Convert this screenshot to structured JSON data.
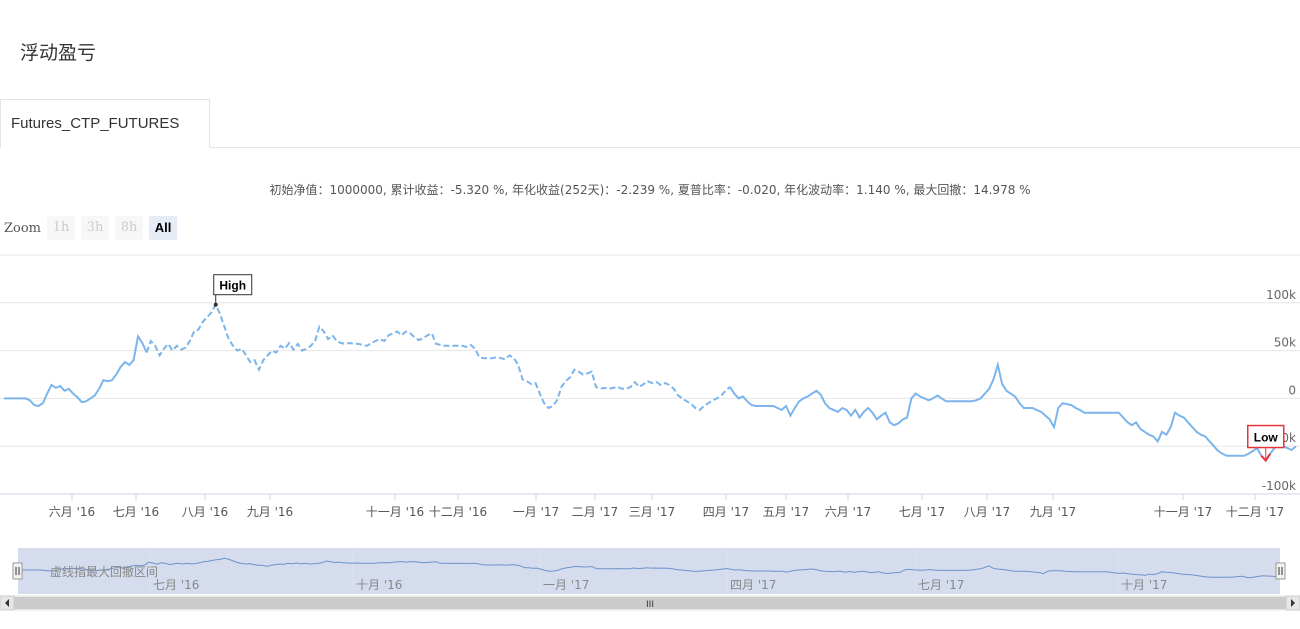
{
  "page": {
    "title": "浮动盈亏",
    "tab_label": "Futures_CTP_FUTURES",
    "stats_text": "初始净值：1000000, 累计收益：-5.320 %, 年化收益(252天)：-2.239 %, 夏普比率：-0.020, 年化波动率：1.140 %, 最大回撤：14.978 %"
  },
  "zoom": {
    "label": "Zoom",
    "buttons": [
      {
        "label": "1h",
        "state": "disabled"
      },
      {
        "label": "3h",
        "state": "disabled"
      },
      {
        "label": "8h",
        "state": "disabled"
      },
      {
        "label": "All",
        "state": "active"
      }
    ]
  },
  "navigator": {
    "legend_text": "虚线指最大回撤区间",
    "ticks": [
      "七月 '16",
      "十月 '16",
      "一月 '17",
      "四月 '17",
      "七月 '17",
      "十月 '17"
    ],
    "scroll_grip": "III"
  },
  "chart_data": {
    "type": "line",
    "x_tick_labels": [
      "六月 '16",
      "七月 '16",
      "八月 '16",
      "九月 '16",
      "十一月 '16",
      "十二月 '16",
      "一月 '17",
      "二月 '17",
      "三月 '17",
      "四月 '17",
      "五月 '17",
      "六月 '17",
      "七月 '17",
      "八月 '17",
      "九月 '17",
      "十一月 '17",
      "十二月 '17"
    ],
    "y_ticks": [
      {
        "value": 100000,
        "label": "100k"
      },
      {
        "value": 50000,
        "label": "50k"
      },
      {
        "value": 0,
        "label": "0"
      },
      {
        "value": -50000,
        "label": "-50k"
      },
      {
        "value": -100000,
        "label": "-100k"
      }
    ],
    "ylim": [
      -100000,
      150000
    ],
    "annotations": [
      {
        "label": "High",
        "value": 98000
      },
      {
        "label": "Low",
        "value": -65000
      }
    ],
    "line_color": "#7cb5ec",
    "low_color": "#e8323c",
    "drawdown_segments": [
      {
        "from_index": 33,
        "to_index": 168
      }
    ],
    "values": [
      0,
      0,
      0,
      0,
      0,
      0,
      -2000,
      -7000,
      -8000,
      -5000,
      5000,
      14000,
      11000,
      13000,
      8000,
      10000,
      5000,
      1000,
      -4000,
      -3000,
      0,
      3000,
      10000,
      19000,
      18000,
      19000,
      25000,
      33000,
      38000,
      35000,
      40000,
      65000,
      58000,
      48000,
      60000,
      55000,
      45000,
      52000,
      57000,
      50000,
      55000,
      51000,
      53000,
      60000,
      70000,
      72000,
      80000,
      85000,
      90000,
      98000,
      88000,
      75000,
      62000,
      55000,
      50000,
      52000,
      45000,
      38000,
      40000,
      30000,
      40000,
      45000,
      50000,
      48000,
      55000,
      52000,
      58000,
      51000,
      57000,
      50000,
      52000,
      55000,
      60000,
      75000,
      70000,
      62000,
      66000,
      60000,
      58000,
      57000,
      58000,
      57000,
      57000,
      56000,
      55000,
      58000,
      60000,
      62000,
      60000,
      66000,
      68000,
      70000,
      66000,
      70000,
      68000,
      64000,
      61000,
      63000,
      66000,
      68000,
      57000,
      56000,
      55000,
      55000,
      55000,
      55000,
      55000,
      54000,
      56000,
      52000,
      43000,
      42000,
      42000,
      42000,
      43000,
      42000,
      41000,
      45000,
      42000,
      35000,
      20000,
      18000,
      15000,
      16000,
      5000,
      -5000,
      -10000,
      -8000,
      -2000,
      12000,
      18000,
      22000,
      30000,
      28000,
      25000,
      26000,
      28000,
      12000,
      10000,
      11000,
      10000,
      11000,
      12000,
      10000,
      10000,
      12000,
      17000,
      12000,
      15000,
      18000,
      16000,
      17000,
      14000,
      16000,
      14000,
      10000,
      3000,
      0,
      -3000,
      -6000,
      -10000,
      -12000,
      -8000,
      -5000,
      -2000,
      0,
      3000,
      8000,
      12000,
      5000,
      0,
      2000,
      -3000,
      -7000,
      -8000,
      -8000,
      -8000,
      -8000,
      -8000,
      -10000,
      -12000,
      -8000,
      -18000,
      -10000,
      -3000,
      0,
      2000,
      5000,
      8000,
      4000,
      -5000,
      -10000,
      -12000,
      -14000,
      -10000,
      -12000,
      -18000,
      -12000,
      -20000,
      -14000,
      -10000,
      -15000,
      -22000,
      -18000,
      -15000,
      -25000,
      -28000,
      -26000,
      -22000,
      -20000,
      0,
      5000,
      2000,
      0,
      -2000,
      0,
      3000,
      0,
      -3000,
      -3000,
      -3000,
      -3000,
      -3000,
      -3000,
      -3000,
      -2000,
      0,
      5000,
      10000,
      20000,
      35000,
      15000,
      8000,
      5000,
      2000,
      -5000,
      -10000,
      -10000,
      -10000,
      -12000,
      -14000,
      -18000,
      -22000,
      -30000,
      -10000,
      -5000,
      -6000,
      -7000,
      -10000,
      -12000,
      -15000,
      -15000,
      -15000,
      -15000,
      -15000,
      -15000,
      -15000,
      -15000,
      -15000,
      -20000,
      -25000,
      -28000,
      -25000,
      -32000,
      -35000,
      -38000,
      -40000,
      -45000,
      -35000,
      -38000,
      -30000,
      -15000,
      -18000,
      -20000,
      -25000,
      -30000,
      -35000,
      -38000,
      -40000,
      -45000,
      -50000,
      -55000,
      -58000,
      -60000,
      -60000,
      -60000,
      -60000,
      -60000,
      -58000,
      -55000,
      -52000,
      -60000,
      -65000,
      -58000,
      -52000,
      -48000,
      -50000,
      -52000,
      -54000,
      -50000
    ]
  }
}
